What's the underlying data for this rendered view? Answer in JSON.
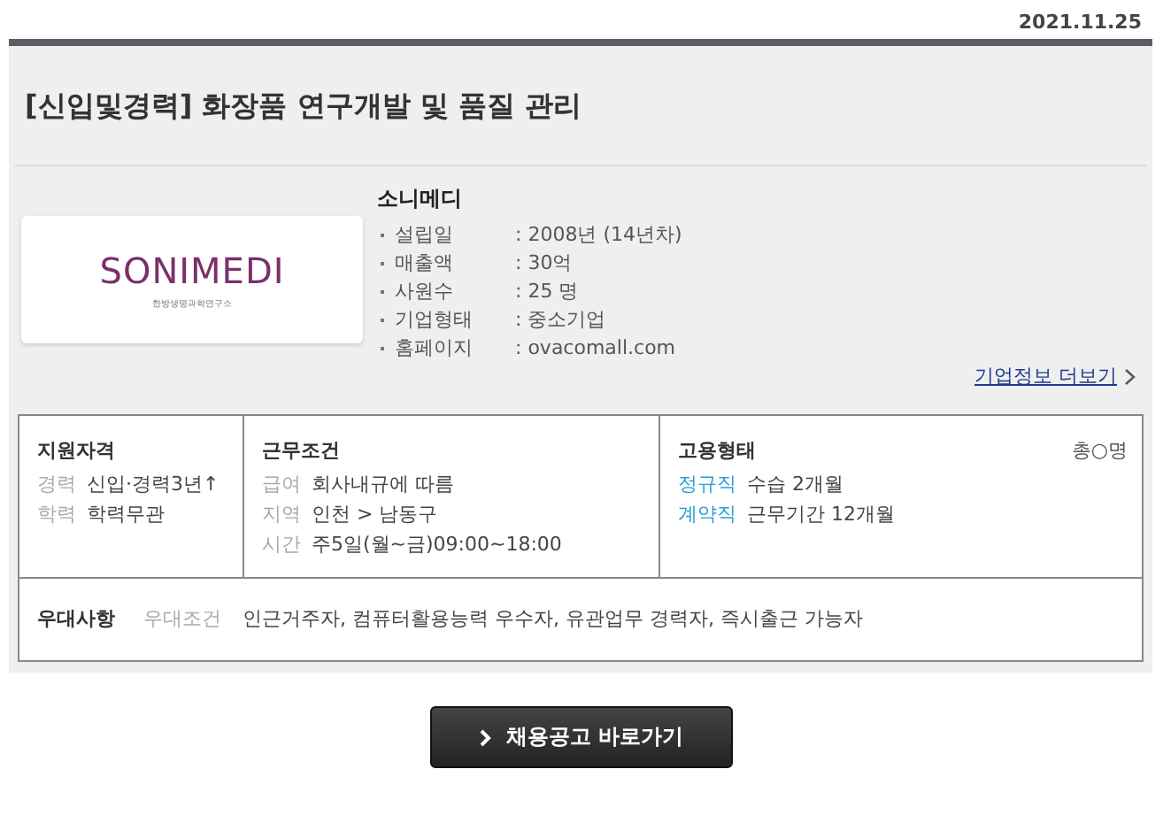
{
  "date": "2021.11.25",
  "title": "[신입및경력] 화장품 연구개발 및 품질 관리",
  "company": {
    "name": "소니메디",
    "logo": {
      "wordmark": "SONIMEDI",
      "tagline": "한방생명과학연구소"
    },
    "info": [
      {
        "label": "설립일",
        "value": ": 2008년 (14년차)"
      },
      {
        "label": "매출액",
        "value": ": 30억"
      },
      {
        "label": "사원수",
        "value": ": 25 명"
      },
      {
        "label": "기업형태",
        "value": ": 중소기업"
      },
      {
        "label": "홈페이지",
        "value": ": ovacomall.com"
      }
    ],
    "more_link": "기업정보 더보기"
  },
  "qualifications": {
    "heading": "지원자격",
    "items": [
      {
        "label": "경력",
        "value": "신입·경력3년↑"
      },
      {
        "label": "학력",
        "value": "학력무관"
      }
    ]
  },
  "conditions": {
    "heading": "근무조건",
    "items": [
      {
        "label": "급여",
        "value": "회사내규에 따름"
      },
      {
        "label": "지역",
        "value": "인천 > 남동구"
      },
      {
        "label": "시간",
        "value": "주5일(월~금)09:00~18:00"
      }
    ]
  },
  "employment": {
    "heading": "고용형태",
    "headcount": "총○명",
    "items": [
      {
        "label": "정규직",
        "value": "수습 2개월"
      },
      {
        "label": "계약직",
        "value": "근무기간 12개월"
      }
    ]
  },
  "preferences": {
    "heading": "우대사항",
    "label": "우대조건",
    "value": "인근거주자, 컴퓨터활용능력 우수자, 유관업무 경력자, 즉시출근 가능자"
  },
  "apply_button": "채용공고 바로가기"
}
